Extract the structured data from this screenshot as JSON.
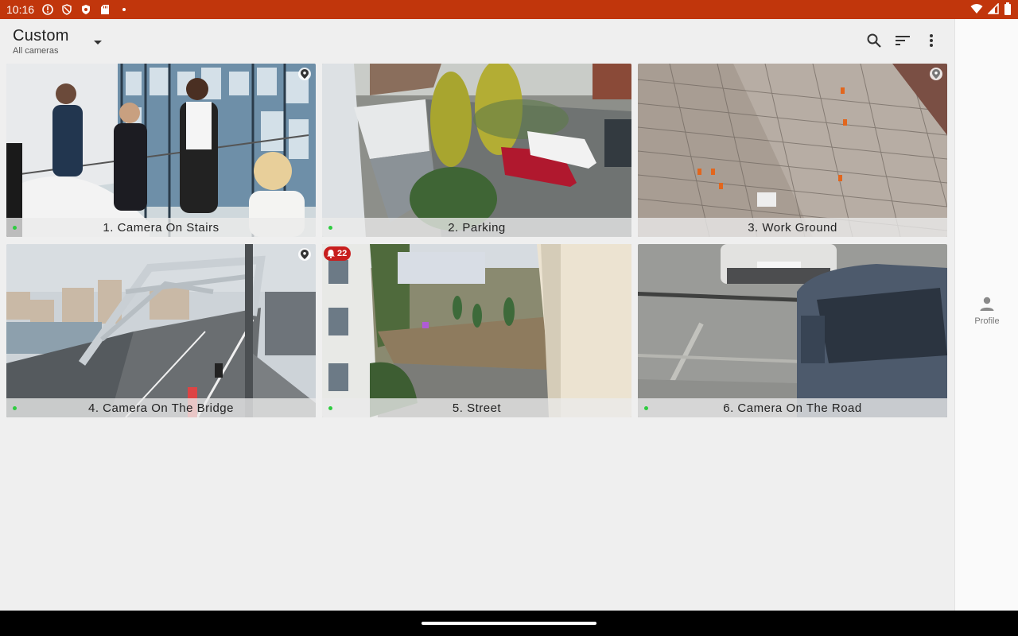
{
  "status_bar": {
    "time": "10:16",
    "left_icons": [
      "info-icon",
      "shield-outline-icon",
      "shield-icon",
      "sd-card-icon",
      "notification-dot-icon"
    ],
    "right_icons": [
      "wifi-icon",
      "signal-icon",
      "battery-icon"
    ]
  },
  "header": {
    "title": "Custom",
    "subtitle": "All cameras"
  },
  "toolbar": {
    "icons": [
      "search-icon",
      "sort-icon",
      "more-vert-icon"
    ]
  },
  "cameras": [
    {
      "name": "1. Camera On Stairs",
      "status": "online",
      "pinned": true,
      "alerts": null
    },
    {
      "name": "2. Parking",
      "status": "online",
      "pinned": false,
      "alerts": null
    },
    {
      "name": "3. Work Ground",
      "status": "online",
      "pinned": true,
      "alerts": null
    },
    {
      "name": "4. Camera On The Bridge",
      "status": "online",
      "pinned": true,
      "alerts": null
    },
    {
      "name": "5. Street",
      "status": "online",
      "pinned": false,
      "alerts": "22"
    },
    {
      "name": "6. Camera On The Road",
      "status": "online",
      "pinned": false,
      "alerts": null
    }
  ],
  "side_rail": {
    "profile_label": "Profile"
  },
  "colors": {
    "status_bar": "#c1360c",
    "online_dot": "#2ecc40",
    "alert_badge": "#c81e1e",
    "background": "#efefef"
  }
}
